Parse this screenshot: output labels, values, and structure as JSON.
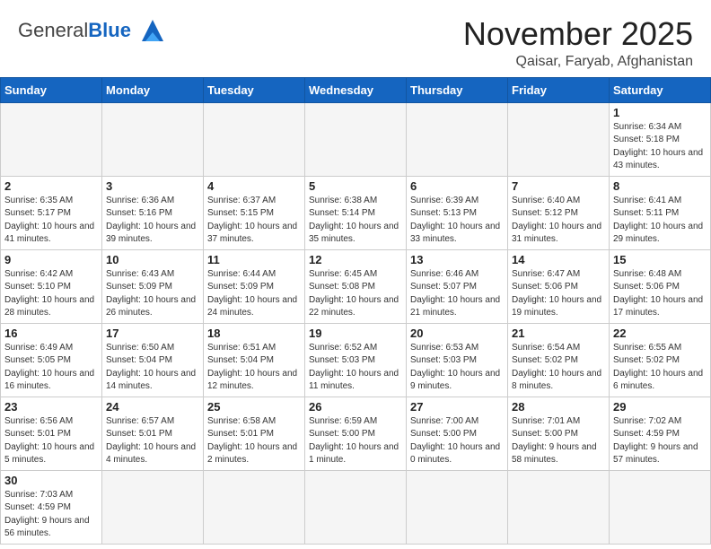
{
  "header": {
    "logo_general": "General",
    "logo_blue": "Blue",
    "title": "November 2025",
    "subtitle": "Qaisar, Faryab, Afghanistan"
  },
  "weekdays": [
    "Sunday",
    "Monday",
    "Tuesday",
    "Wednesday",
    "Thursday",
    "Friday",
    "Saturday"
  ],
  "weeks": [
    [
      {
        "date": "",
        "info": ""
      },
      {
        "date": "",
        "info": ""
      },
      {
        "date": "",
        "info": ""
      },
      {
        "date": "",
        "info": ""
      },
      {
        "date": "",
        "info": ""
      },
      {
        "date": "",
        "info": ""
      },
      {
        "date": "1",
        "info": "Sunrise: 6:34 AM\nSunset: 5:18 PM\nDaylight: 10 hours and 43 minutes."
      }
    ],
    [
      {
        "date": "2",
        "info": "Sunrise: 6:35 AM\nSunset: 5:17 PM\nDaylight: 10 hours and 41 minutes."
      },
      {
        "date": "3",
        "info": "Sunrise: 6:36 AM\nSunset: 5:16 PM\nDaylight: 10 hours and 39 minutes."
      },
      {
        "date": "4",
        "info": "Sunrise: 6:37 AM\nSunset: 5:15 PM\nDaylight: 10 hours and 37 minutes."
      },
      {
        "date": "5",
        "info": "Sunrise: 6:38 AM\nSunset: 5:14 PM\nDaylight: 10 hours and 35 minutes."
      },
      {
        "date": "6",
        "info": "Sunrise: 6:39 AM\nSunset: 5:13 PM\nDaylight: 10 hours and 33 minutes."
      },
      {
        "date": "7",
        "info": "Sunrise: 6:40 AM\nSunset: 5:12 PM\nDaylight: 10 hours and 31 minutes."
      },
      {
        "date": "8",
        "info": "Sunrise: 6:41 AM\nSunset: 5:11 PM\nDaylight: 10 hours and 29 minutes."
      }
    ],
    [
      {
        "date": "9",
        "info": "Sunrise: 6:42 AM\nSunset: 5:10 PM\nDaylight: 10 hours and 28 minutes."
      },
      {
        "date": "10",
        "info": "Sunrise: 6:43 AM\nSunset: 5:09 PM\nDaylight: 10 hours and 26 minutes."
      },
      {
        "date": "11",
        "info": "Sunrise: 6:44 AM\nSunset: 5:09 PM\nDaylight: 10 hours and 24 minutes."
      },
      {
        "date": "12",
        "info": "Sunrise: 6:45 AM\nSunset: 5:08 PM\nDaylight: 10 hours and 22 minutes."
      },
      {
        "date": "13",
        "info": "Sunrise: 6:46 AM\nSunset: 5:07 PM\nDaylight: 10 hours and 21 minutes."
      },
      {
        "date": "14",
        "info": "Sunrise: 6:47 AM\nSunset: 5:06 PM\nDaylight: 10 hours and 19 minutes."
      },
      {
        "date": "15",
        "info": "Sunrise: 6:48 AM\nSunset: 5:06 PM\nDaylight: 10 hours and 17 minutes."
      }
    ],
    [
      {
        "date": "16",
        "info": "Sunrise: 6:49 AM\nSunset: 5:05 PM\nDaylight: 10 hours and 16 minutes."
      },
      {
        "date": "17",
        "info": "Sunrise: 6:50 AM\nSunset: 5:04 PM\nDaylight: 10 hours and 14 minutes."
      },
      {
        "date": "18",
        "info": "Sunrise: 6:51 AM\nSunset: 5:04 PM\nDaylight: 10 hours and 12 minutes."
      },
      {
        "date": "19",
        "info": "Sunrise: 6:52 AM\nSunset: 5:03 PM\nDaylight: 10 hours and 11 minutes."
      },
      {
        "date": "20",
        "info": "Sunrise: 6:53 AM\nSunset: 5:03 PM\nDaylight: 10 hours and 9 minutes."
      },
      {
        "date": "21",
        "info": "Sunrise: 6:54 AM\nSunset: 5:02 PM\nDaylight: 10 hours and 8 minutes."
      },
      {
        "date": "22",
        "info": "Sunrise: 6:55 AM\nSunset: 5:02 PM\nDaylight: 10 hours and 6 minutes."
      }
    ],
    [
      {
        "date": "23",
        "info": "Sunrise: 6:56 AM\nSunset: 5:01 PM\nDaylight: 10 hours and 5 minutes."
      },
      {
        "date": "24",
        "info": "Sunrise: 6:57 AM\nSunset: 5:01 PM\nDaylight: 10 hours and 4 minutes."
      },
      {
        "date": "25",
        "info": "Sunrise: 6:58 AM\nSunset: 5:01 PM\nDaylight: 10 hours and 2 minutes."
      },
      {
        "date": "26",
        "info": "Sunrise: 6:59 AM\nSunset: 5:00 PM\nDaylight: 10 hours and 1 minute."
      },
      {
        "date": "27",
        "info": "Sunrise: 7:00 AM\nSunset: 5:00 PM\nDaylight: 10 hours and 0 minutes."
      },
      {
        "date": "28",
        "info": "Sunrise: 7:01 AM\nSunset: 5:00 PM\nDaylight: 9 hours and 58 minutes."
      },
      {
        "date": "29",
        "info": "Sunrise: 7:02 AM\nSunset: 4:59 PM\nDaylight: 9 hours and 57 minutes."
      }
    ],
    [
      {
        "date": "30",
        "info": "Sunrise: 7:03 AM\nSunset: 4:59 PM\nDaylight: 9 hours and 56 minutes."
      },
      {
        "date": "",
        "info": ""
      },
      {
        "date": "",
        "info": ""
      },
      {
        "date": "",
        "info": ""
      },
      {
        "date": "",
        "info": ""
      },
      {
        "date": "",
        "info": ""
      },
      {
        "date": "",
        "info": ""
      }
    ]
  ]
}
